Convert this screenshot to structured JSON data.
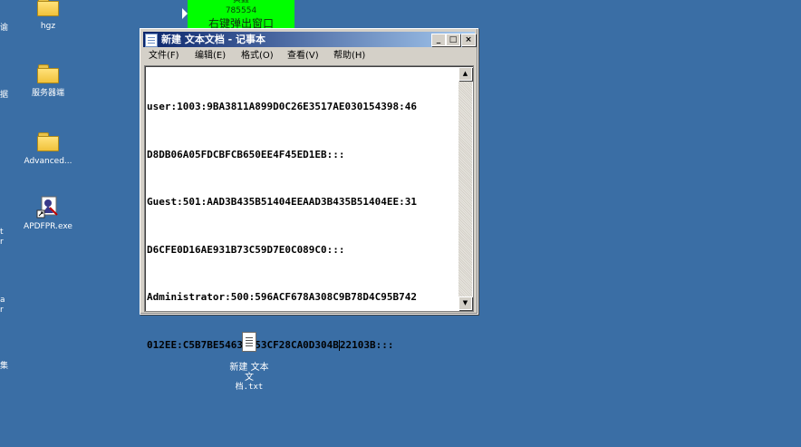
{
  "desktop": {
    "left_edge_labels": [
      "谕",
      "据",
      "t",
      "r",
      "a",
      "r",
      "集"
    ],
    "icons": [
      {
        "label": "hgz",
        "icon": "folder-icon"
      },
      {
        "label": "服务器端",
        "icon": "folder-icon"
      },
      {
        "label": "Advanced...",
        "icon": "folder-icon"
      },
      {
        "label": "APDFPR.exe",
        "icon": "apdfpr-app-icon"
      }
    ],
    "file": {
      "name_line1": "新建 文本文",
      "name_line2": "档.txt",
      "icon": "text-file-icon"
    }
  },
  "overlay": {
    "line1": "黄鑫",
    "line2": "785554",
    "line3": "右键弹出窗口",
    "color": "#00ff00"
  },
  "window": {
    "title": "新建 文本文档 - 记事本",
    "buttons": {
      "minimize": "_",
      "maximize": "□",
      "close": "×"
    },
    "menu": [
      "文件(F)",
      "编辑(E)",
      "格式(O)",
      "查看(V)",
      "帮助(H)"
    ],
    "content": {
      "line1": "user:1003:9BA3811A899D0C26E3517AE030154398:46",
      "line2": "D8DB06A05FDCBFCB650EE4F45ED1EB:::",
      "line3": "Guest:501:AAD3B435B51404EEAAD3B435B51404EE:31",
      "line4": "D6CFE0D16AE931B73C59D7E0C089C0:::",
      "line5": "Administrator:500:596ACF678A308C9B78D4C95B742",
      "line6a": "012EE:C5B7BE5463F053CF28CA0D304B",
      "line6b": "22103B:::"
    },
    "scroll_up": "▲",
    "scroll_down": "▼"
  },
  "colors": {
    "desktop": "#3a6ea5",
    "titlebar_start": "#0a246a",
    "titlebar_end": "#a6caf0",
    "chrome": "#d4d0c8"
  }
}
